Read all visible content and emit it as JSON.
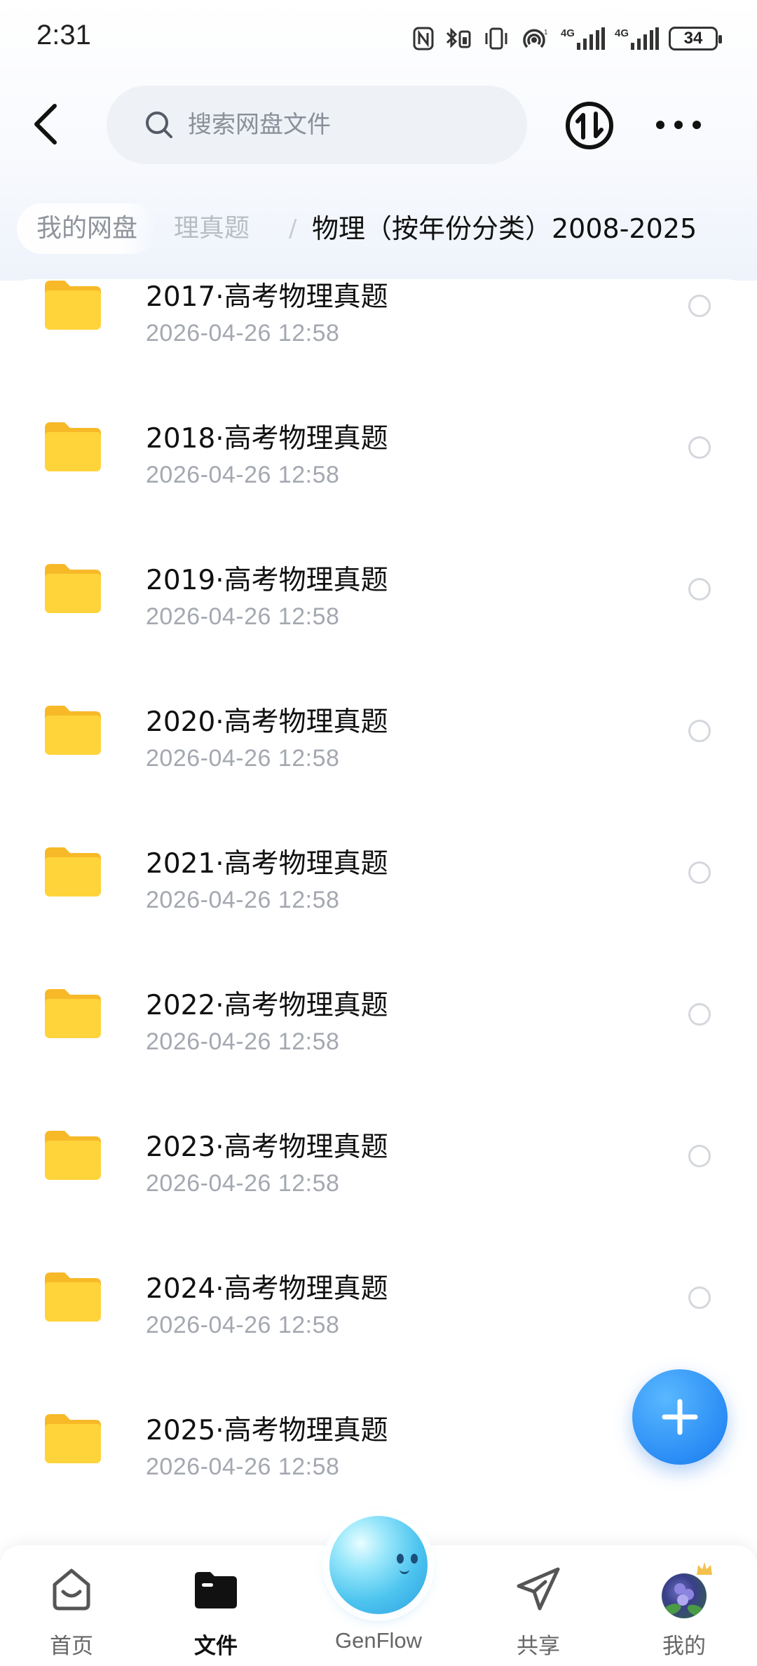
{
  "status_bar": {
    "time": "2:31",
    "signal_label_1": "4G",
    "signal_label_2": "4G",
    "battery": "34"
  },
  "toolbar": {
    "search_placeholder": "搜索网盘文件",
    "icons": [
      "back-chevron-icon",
      "search-icon",
      "sort-icon",
      "more-icon"
    ]
  },
  "breadcrumb": {
    "root": "我的网盘",
    "middle": "理真题",
    "separator": "/",
    "current": "物理（按年份分类）2008-2025"
  },
  "files": [
    {
      "name": "2017·高考物理真题",
      "date": "2026-04-26  12:58"
    },
    {
      "name": "2018·高考物理真题",
      "date": "2026-04-26  12:58"
    },
    {
      "name": "2019·高考物理真题",
      "date": "2026-04-26  12:58"
    },
    {
      "name": "2020·高考物理真题",
      "date": "2026-04-26  12:58"
    },
    {
      "name": "2021·高考物理真题",
      "date": "2026-04-26  12:58"
    },
    {
      "name": "2022·高考物理真题",
      "date": "2026-04-26  12:58"
    },
    {
      "name": "2023·高考物理真题",
      "date": "2026-04-26  12:58"
    },
    {
      "name": "2024·高考物理真题",
      "date": "2026-04-26  12:58"
    },
    {
      "name": "2025·高考物理真题",
      "date": "2026-04-26  12:58"
    }
  ],
  "bottom_nav": {
    "home": "首页",
    "files": "文件",
    "genflow": "GenFlow",
    "share": "共享",
    "me": "我的",
    "active": "files"
  },
  "colors": {
    "accent_blue": "#2a8cf5",
    "folder_yellow": "#ffd43b",
    "text_primary": "#111111",
    "text_secondary": "#a4a8b0"
  }
}
